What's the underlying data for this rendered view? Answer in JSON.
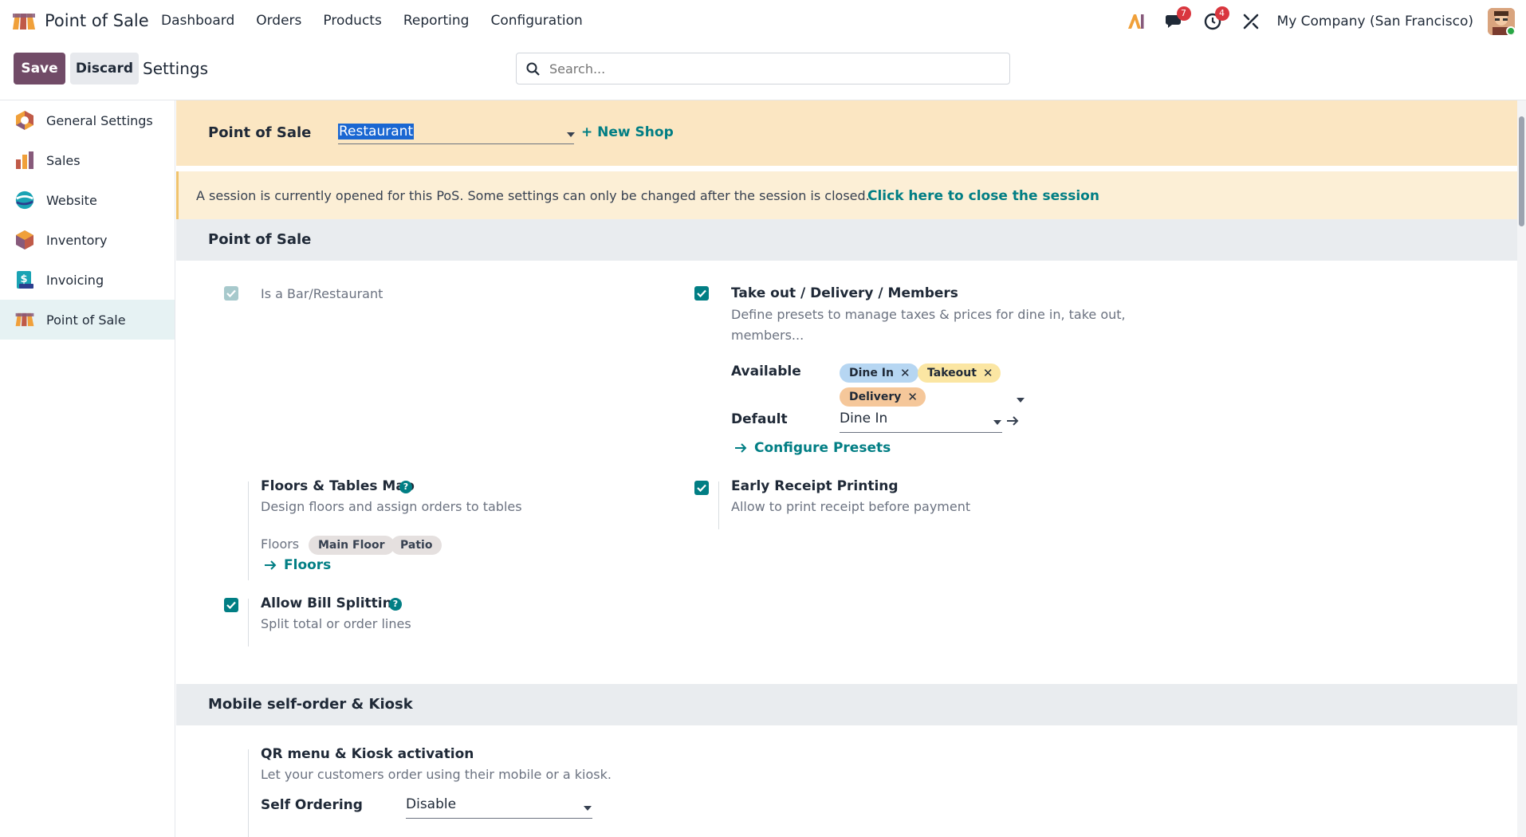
{
  "app": {
    "name": "Point of Sale"
  },
  "menu": [
    "Dashboard",
    "Orders",
    "Products",
    "Reporting",
    "Configuration"
  ],
  "navbar": {
    "chat_count": "7",
    "activity_count": "4",
    "company": "My Company (San Francisco)"
  },
  "control": {
    "save_label": "Save",
    "discard_label": "Discard",
    "title": "Settings",
    "search_placeholder": "Search..."
  },
  "sidebar": {
    "items": [
      {
        "label": "General Settings",
        "icon": "settings-app-icon"
      },
      {
        "label": "Sales",
        "icon": "sales-app-icon"
      },
      {
        "label": "Website",
        "icon": "website-app-icon"
      },
      {
        "label": "Inventory",
        "icon": "inventory-app-icon"
      },
      {
        "label": "Invoicing",
        "icon": "invoicing-app-icon"
      },
      {
        "label": "Point of Sale",
        "icon": "pos-app-icon",
        "active": true
      }
    ]
  },
  "shop": {
    "label": "Point of Sale",
    "value": "Restaurant",
    "new_shop": "+ New Shop"
  },
  "warning": {
    "text": "A session is currently opened for this PoS. Some settings can only be changed after the session is closed.",
    "link": "Click here to close the session"
  },
  "sections": {
    "pos": {
      "title": "Point of Sale",
      "bar_restaurant": {
        "label": "Is a Bar/Restaurant",
        "checked": true
      },
      "takeout": {
        "title": "Take out / Delivery / Members",
        "desc_line1": "Define presets to manage taxes & prices for dine in, take out,",
        "desc_line2": "members...",
        "available_label": "Available",
        "tags": [
          "Dine In",
          "Takeout",
          "Delivery"
        ],
        "default_label": "Default",
        "default_value": "Dine In",
        "configure_link": "Configure Presets",
        "checked": true
      },
      "floors": {
        "title": "Floors & Tables Map",
        "desc": "Design floors and assign orders to tables",
        "floors_label": "Floors",
        "floors": [
          "Main Floor",
          "Patio"
        ],
        "floors_link": "Floors"
      },
      "early_receipt": {
        "title": "Early Receipt Printing",
        "desc": "Allow to print receipt before payment",
        "checked": true
      },
      "bill_split": {
        "title": "Allow Bill Splitting",
        "desc": "Split total or order lines",
        "checked": true
      }
    },
    "kiosk": {
      "title": "Mobile self-order & Kiosk",
      "qr": {
        "title": "QR menu & Kiosk activation",
        "desc": "Let your customers order using their mobile or a kiosk."
      },
      "self_ordering_label": "Self Ordering",
      "self_ordering_value": "Disable"
    }
  },
  "colors": {
    "primary": "#714b67",
    "accent": "#017e84",
    "shop_band": "#fbe6c2",
    "warn_band": "#fcefd6"
  }
}
